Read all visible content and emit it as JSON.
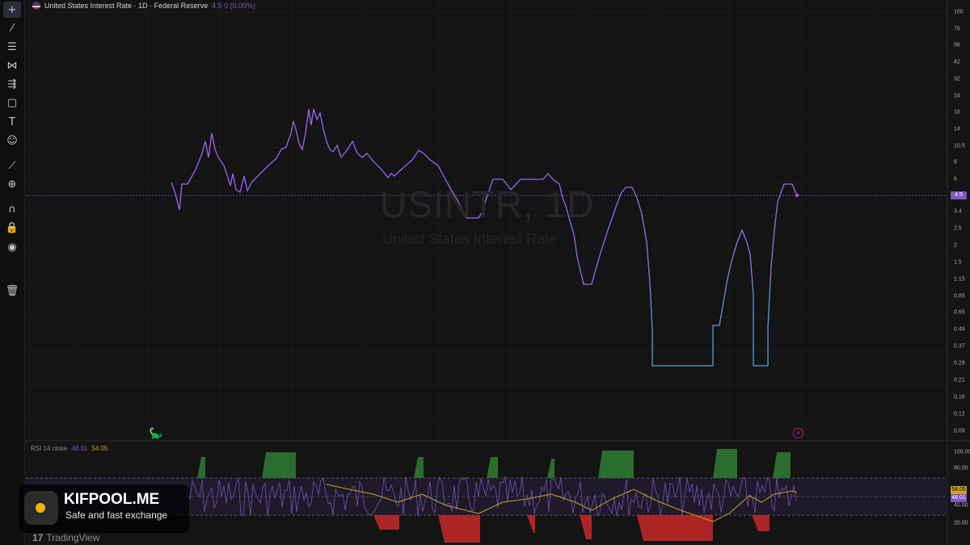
{
  "legend": {
    "title": "United States Interest Rate · 1D · Federal Reserve",
    "values": "4.5  0 (0.00%)"
  },
  "watermark": {
    "symbol": "USINTR, 1D",
    "name": "United States Interest Rate"
  },
  "rsi_legend": {
    "label": "RSI 14 close",
    "value1": "48.01",
    "value2": "54.05"
  },
  "tools": [
    {
      "icon": "crosshair-icon",
      "glyph": "+"
    },
    {
      "icon": "trend-line-icon",
      "glyph": "⁄"
    },
    {
      "icon": "horizontal-lines-icon",
      "glyph": "☰"
    },
    {
      "icon": "pattern-icon",
      "glyph": "⋈"
    },
    {
      "icon": "projection-icon",
      "glyph": "⇶"
    },
    {
      "icon": "rectangle-icon",
      "glyph": "▢"
    },
    {
      "icon": "text-icon",
      "glyph": "T"
    },
    {
      "icon": "emoji-icon",
      "glyph": "☺"
    },
    {
      "icon": "ruler-icon",
      "glyph": "⟋"
    },
    {
      "icon": "zoom-icon",
      "glyph": "⊕"
    },
    {
      "icon": "magnet-icon",
      "glyph": "∩"
    },
    {
      "icon": "lock-icon",
      "glyph": "🔒"
    },
    {
      "icon": "eye-icon",
      "glyph": "◉"
    },
    {
      "icon": "trash-icon",
      "glyph": "🗑"
    }
  ],
  "price_axis": [
    "100",
    "76",
    "56",
    "42",
    "32",
    "24",
    "18",
    "14",
    "10.5",
    "8",
    "6",
    "3.4",
    "2.5",
    "2",
    "1.5",
    "1.15",
    "0.85",
    "0.65",
    "0.49",
    "0.37",
    "0.28",
    "0.21",
    "0.16",
    "0.12",
    "0.09"
  ],
  "current_price": "4.5",
  "rsi_axis": [
    "100.00",
    "80.00",
    "40.00",
    "20.00"
  ],
  "rsi_tags": {
    "ma": "54.05",
    "rsi": "48.01"
  },
  "colors": {
    "price_line": "#9c64f0",
    "price_line_low": "#4aa3e0",
    "rsi": "#7e57c2",
    "rsi_ma": "#c9a227",
    "overbought": "#2e7d32",
    "oversold": "#c62828"
  },
  "banner": {
    "title": "KIFPOOL.ME",
    "subtitle": "Safe and fast exchange"
  },
  "brand": {
    "mark": "17",
    "name": "TradingView"
  },
  "icons": {
    "flash": "⚡",
    "dino": "🦕"
  }
}
